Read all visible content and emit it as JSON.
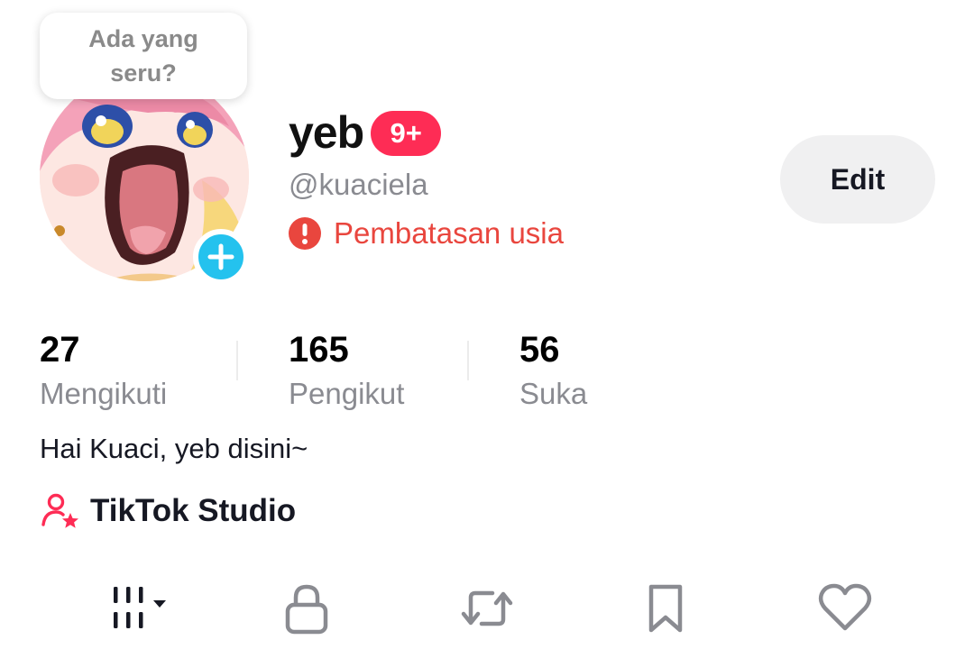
{
  "prompt_bubble": {
    "text": "Ada yang seru?"
  },
  "profile": {
    "display_name": "yeb",
    "notification_badge": "9+",
    "username": "@kuaciela",
    "age_restriction_label": "Pembatasan usia",
    "edit_label": "Edit",
    "bio": "Hai Kuaci, yeb disini~"
  },
  "stats": [
    {
      "value": "27",
      "label": "Mengikuti"
    },
    {
      "value": "165",
      "label": "Pengikut"
    },
    {
      "value": "56",
      "label": "Suka"
    }
  ],
  "studio": {
    "label": "TikTok Studio",
    "icon": "creator-star-icon"
  },
  "tabs": [
    {
      "icon": "videos-grid-icon",
      "selected": true
    },
    {
      "icon": "lock-icon"
    },
    {
      "icon": "repost-icon"
    },
    {
      "icon": "bookmark-icon"
    },
    {
      "icon": "heart-icon"
    }
  ],
  "colors": {
    "accent": "#fe2c55",
    "warning": "#e9463e",
    "add_badge": "#24c2ee",
    "secondary_text": "#8a8b91",
    "edit_button_bg": "#f0f0f1"
  }
}
